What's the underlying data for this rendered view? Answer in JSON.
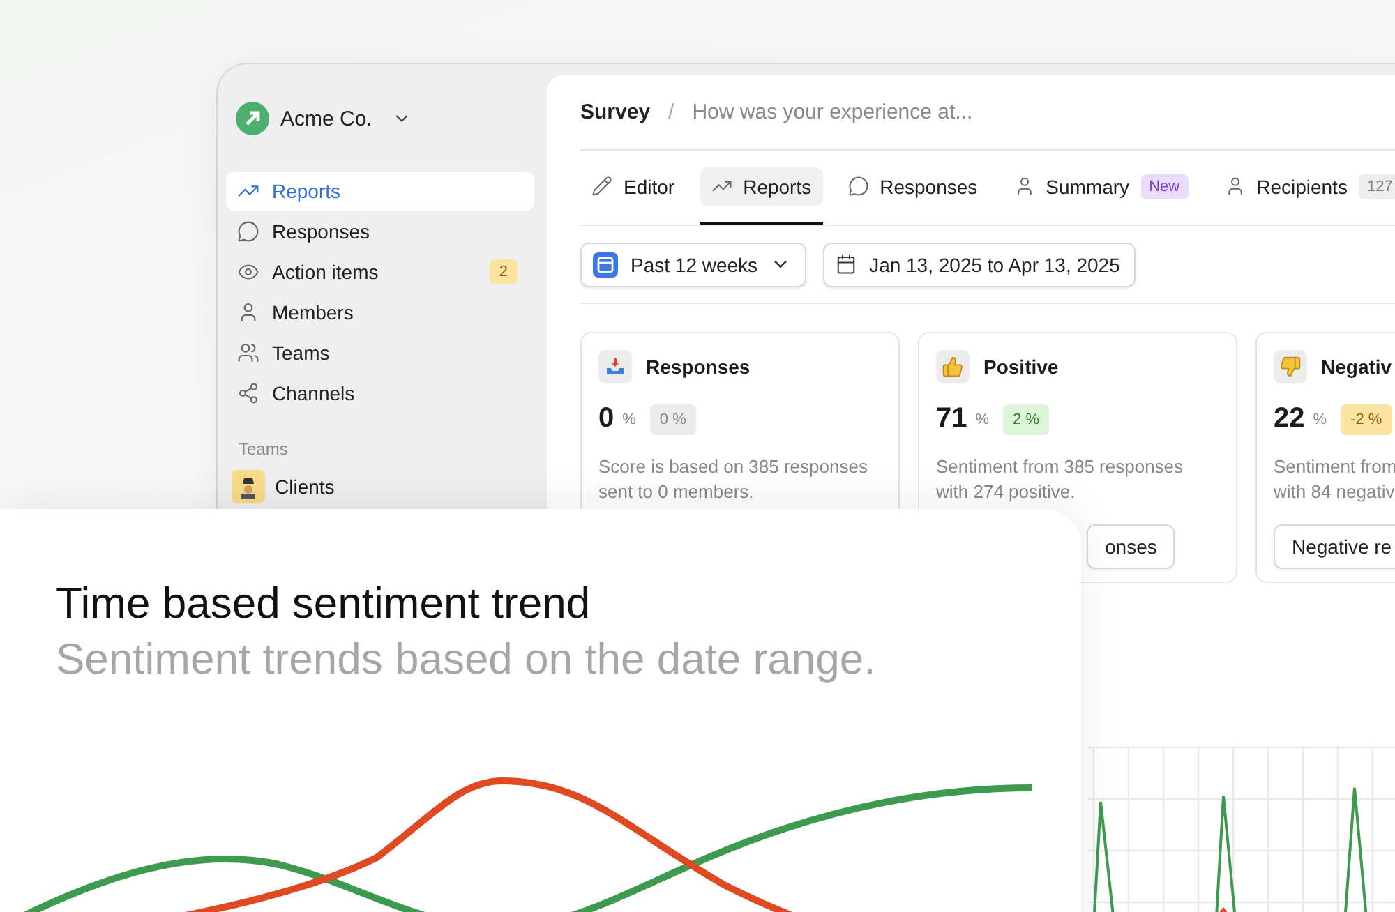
{
  "workspace": {
    "name": "Acme Co."
  },
  "sidebar": {
    "items": [
      {
        "label": "Reports",
        "selected": true
      },
      {
        "label": "Responses",
        "selected": false
      },
      {
        "label": "Action items",
        "selected": false,
        "badge": "2"
      },
      {
        "label": "Members",
        "selected": false
      },
      {
        "label": "Teams",
        "selected": false
      },
      {
        "label": "Channels",
        "selected": false
      }
    ],
    "section_title": "Teams",
    "teams": [
      {
        "label": "Clients"
      }
    ]
  },
  "breadcrumb": {
    "root": "Survey",
    "separator": "/",
    "current": "How was your experience at..."
  },
  "tabs": [
    {
      "label": "Editor",
      "selected": false
    },
    {
      "label": "Reports",
      "selected": true
    },
    {
      "label": "Responses",
      "selected": false
    },
    {
      "label": "Summary",
      "selected": false,
      "badge": {
        "text": "New",
        "kind": "new"
      }
    },
    {
      "label": "Recipients",
      "selected": false,
      "badge": {
        "text": "127",
        "kind": "count"
      }
    }
  ],
  "filters": {
    "period": "Past 12 weeks",
    "date_range": "Jan 13, 2025 to Apr 13, 2025"
  },
  "cards": [
    {
      "title": "Responses",
      "value": "0",
      "unit": "%",
      "delta": {
        "text": "0 %",
        "kind": "neutral"
      },
      "description": "Score is based on 385 responses\nsent to 0 members."
    },
    {
      "title": "Positive",
      "value": "71",
      "unit": "%",
      "delta": {
        "text": "2 %",
        "kind": "up"
      },
      "description": "Sentiment from 385 responses\nwith 274 positive.",
      "button": "onses"
    },
    {
      "title": "Negativ",
      "value": "22",
      "unit": "%",
      "delta": {
        "text": "-2 %",
        "kind": "down"
      },
      "description": "Sentiment from\nwith 84 negativ",
      "button": "Negative re"
    }
  ],
  "overlay": {
    "title": "Time based sentiment trend",
    "subtitle": "Sentiment trends based on the date range."
  }
}
